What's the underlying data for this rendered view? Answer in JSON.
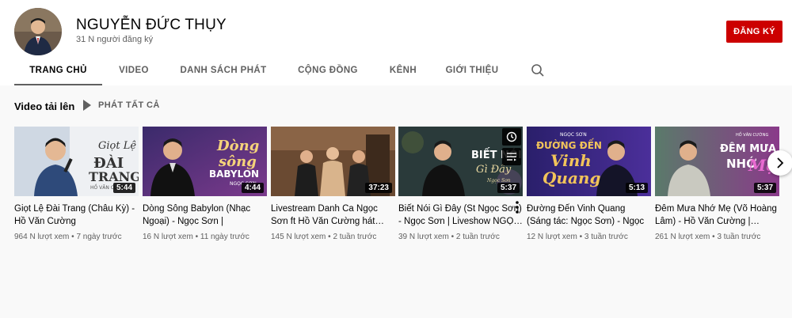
{
  "channel": {
    "name": "NGUYỄN ĐỨC THỤY",
    "subscribers": "31 N người đăng ký",
    "subscribe_label": "ĐĂNG KÝ"
  },
  "tabs": [
    {
      "label": "TRANG CHỦ",
      "active": true
    },
    {
      "label": "VIDEO",
      "active": false
    },
    {
      "label": "DANH SÁCH PHÁT",
      "active": false
    },
    {
      "label": "CỘNG ĐỒNG",
      "active": false
    },
    {
      "label": "KÊNH",
      "active": false
    },
    {
      "label": "GIỚI THIỆU",
      "active": false
    }
  ],
  "section": {
    "title": "Video tải lên",
    "play_all": "PHÁT TẤT CẢ"
  },
  "videos": [
    {
      "title": "Giọt Lệ Đài Trang (Châu Kỳ) - Hồ Văn Cường",
      "views": "964 N lượt xem",
      "age": "7 ngày trước",
      "duration": "5:44",
      "thumb_text": [
        "Giọt Lệ",
        "ĐÀI",
        "TRANG",
        "HỒ VĂN CƯỜNG"
      ]
    },
    {
      "title": "Dòng Sông Babylon (Nhạc Ngoại) - Ngọc Sơn | Liveshow…",
      "views": "16 N lượt xem",
      "age": "11 ngày trước",
      "duration": "4:44",
      "thumb_text": [
        "Dòng",
        "sông",
        "BABYLON",
        "NGỌC SƠN"
      ]
    },
    {
      "title": "Livestream Danh Ca Ngọc Sơn ft Hồ Văn Cường hát…",
      "views": "145 N lượt xem",
      "age": "2 tuần trước",
      "duration": "37:23",
      "thumb_text": []
    },
    {
      "title": "Biết Nói Gì Đây (St Ngọc Sơn) - Ngọc Sơn | Liveshow NGỌ…",
      "views": "39 N lượt xem",
      "age": "2 tuần trước",
      "duration": "5:37",
      "thumb_text": [
        "BIẾT NÓI",
        "Gì Đây",
        "Ngọc Sơn"
      ]
    },
    {
      "title": "Đường Đến Vinh Quang (Sáng tác: Ngọc Sơn) - Ngọc Sơn |…",
      "views": "12 N lượt xem",
      "age": "3 tuần trước",
      "duration": "5:13",
      "thumb_text": [
        "NGỌC SƠN",
        "ĐƯỜNG ĐẾN",
        "Vinh",
        "Quang"
      ]
    },
    {
      "title": "Đêm Mưa Nhớ Mẹ (Võ Hoàng Lâm) - Hồ Văn Cường |…",
      "views": "261 N lượt xem",
      "age": "3 tuần trước",
      "duration": "5:37",
      "thumb_text": [
        "HỒ VĂN CƯỜNG",
        "ĐÊM MƯA",
        "NHỚ",
        "Mẹ"
      ]
    }
  ],
  "icons": {
    "search": "search-icon",
    "play": "play-icon",
    "watch_later": "clock-icon",
    "add_to_queue": "queue-icon",
    "more": "more-vert-icon",
    "next": "chevron-right-icon"
  },
  "colors": {
    "subscribe_bg": "#cc0000",
    "page_bg": "#f9f9f9",
    "header_bg": "#ffffff"
  }
}
